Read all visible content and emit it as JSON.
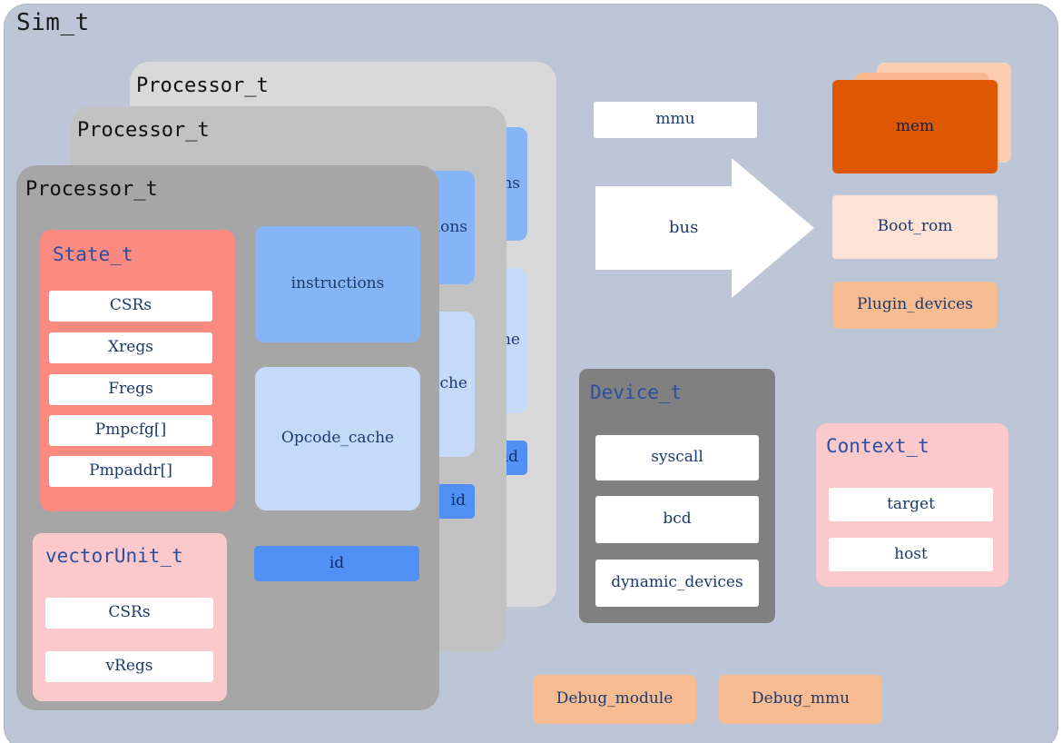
{
  "diagram": {
    "title": "Sim_t",
    "background_color": "#bcc6d6"
  },
  "processor_stack": {
    "label_back": "Processor_t",
    "label_mid": "Processor_t",
    "label_front": "Processor_t",
    "card_colors": {
      "back": "#d9d9d9",
      "mid": "#c2c2c2",
      "front": "#a6a6a6"
    }
  },
  "state": {
    "title": "State_t",
    "color": "#fb8a81",
    "fields": [
      {
        "label": "CSRs"
      },
      {
        "label": "Xregs"
      },
      {
        "label": "Fregs"
      },
      {
        "label": "Pmpcfg[]"
      },
      {
        "label": "Pmpaddr[]"
      }
    ]
  },
  "vector_unit": {
    "title": "vectorUnit_t",
    "color": "#fbc9cb",
    "fields": [
      {
        "label": "CSRs"
      },
      {
        "label": "vRegs"
      }
    ]
  },
  "processor_members": {
    "instructions": {
      "label": "instructions",
      "color": "#86b5f7"
    },
    "opcode_cache": {
      "label": "Opcode_cache",
      "color": "#c5d9f8"
    },
    "id": {
      "label": "id",
      "color": "#5190f5"
    }
  },
  "mmu": {
    "label": "mmu",
    "color": "#ffffff"
  },
  "bus": {
    "label": "bus",
    "color": "#ffffff"
  },
  "memory": {
    "mem": {
      "label": "mem",
      "color": "#dd5800"
    },
    "boot_rom": {
      "label": "Boot_rom",
      "color": "#fce3d5"
    },
    "plugin_devices": {
      "label": "Plugin_devices",
      "color": "#f8bc92"
    }
  },
  "device": {
    "title": "Device_t",
    "color": "#808080",
    "fields": [
      {
        "label": "syscall"
      },
      {
        "label": "bcd"
      },
      {
        "label": "dynamic_devices"
      }
    ]
  },
  "context": {
    "title": "Context_t",
    "color": "#fbc9cb",
    "fields": [
      {
        "label": "target"
      },
      {
        "label": "host"
      }
    ]
  },
  "debug": {
    "module": {
      "label": "Debug_module",
      "color": "#f8bc92"
    },
    "mmu": {
      "label": "Debug_mmu",
      "color": "#f8bc92"
    }
  }
}
